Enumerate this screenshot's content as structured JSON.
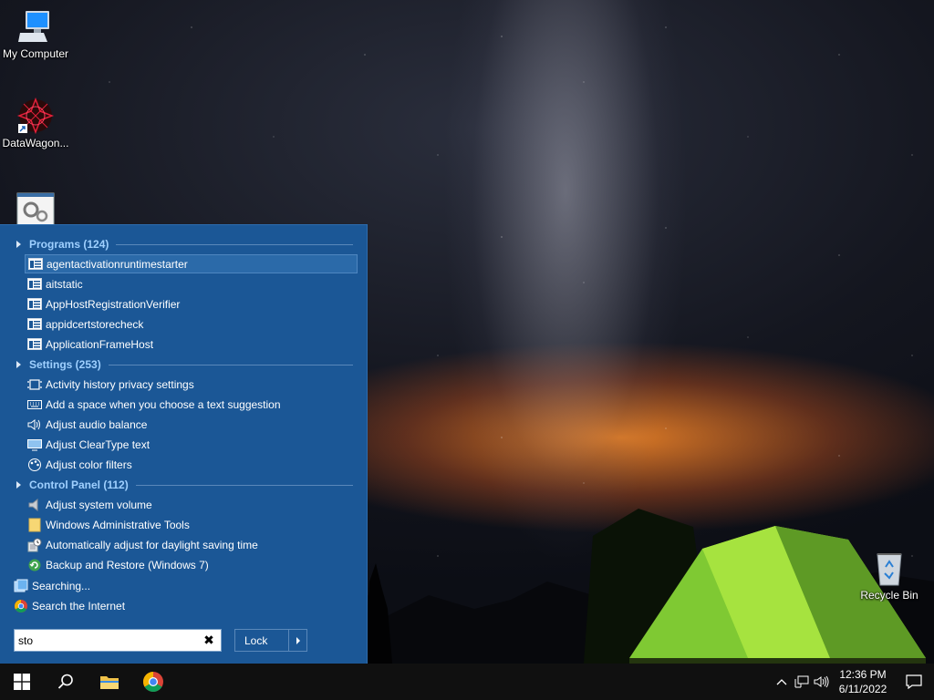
{
  "desktop": {
    "icons": [
      {
        "label": "My Computer",
        "icon": "computer-icon"
      },
      {
        "label": "DataWagon...",
        "icon": "datawagon-shortcut-icon"
      },
      {
        "label": "",
        "icon": "settings-app-icon"
      },
      {
        "label": "Recycle Bin",
        "icon": "recycle-bin-icon"
      }
    ]
  },
  "start_menu": {
    "sections": {
      "programs": {
        "title": "Programs (124)"
      },
      "settings": {
        "title": "Settings (253)"
      },
      "control_panel": {
        "title": "Control Panel (112)"
      }
    },
    "programs": [
      {
        "label": "agentactivationruntimestarter",
        "icon": "app-window-icon",
        "selected": true
      },
      {
        "label": "aitstatic",
        "icon": "app-window-icon"
      },
      {
        "label": "AppHostRegistrationVerifier",
        "icon": "app-window-icon"
      },
      {
        "label": "appidcertstorecheck",
        "icon": "app-window-icon"
      },
      {
        "label": "ApplicationFrameHost",
        "icon": "app-window-icon"
      }
    ],
    "settings": [
      {
        "label": "Activity history privacy settings",
        "icon": "activity-history-icon"
      },
      {
        "label": "Add a space when you choose a text suggestion",
        "icon": "keyboard-icon"
      },
      {
        "label": "Adjust audio balance",
        "icon": "speaker-icon"
      },
      {
        "label": "Adjust ClearType text",
        "icon": "monitor-icon"
      },
      {
        "label": "Adjust color filters",
        "icon": "color-filter-icon"
      }
    ],
    "control_panel": [
      {
        "label": "Adjust system volume",
        "icon": "volume-icon"
      },
      {
        "label": "Windows Administrative Tools",
        "icon": "folder-icon"
      },
      {
        "label": "Automatically adjust for daylight saving time",
        "icon": "clock-calendar-icon"
      },
      {
        "label": "Backup and Restore (Windows 7)",
        "icon": "backup-restore-icon"
      }
    ],
    "extra": [
      {
        "label": "Searching...",
        "icon": "searching-icon"
      },
      {
        "label": "Search the Internet",
        "icon": "chrome-icon"
      }
    ],
    "search": {
      "value": "sto",
      "clear_symbol": "✖"
    },
    "lock_button": {
      "label": "Lock"
    }
  },
  "taskbar": {
    "items": [
      "start-button",
      "search-button",
      "file-explorer-button",
      "chrome-button"
    ],
    "clock": {
      "time": "12:36 PM",
      "date": "6/11/2022"
    }
  },
  "colors": {
    "menu_bg": "#1b5796",
    "section_header": "#9fd0ff",
    "taskbar_bg": "#101010"
  }
}
